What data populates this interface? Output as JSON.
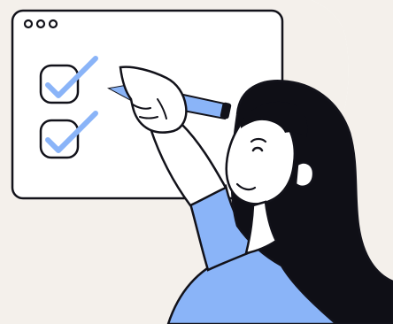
{
  "illustration": {
    "subject": "woman-checking-off-checklist-on-board",
    "icons": [
      "window-dots-icon",
      "checkbox-checked-icon",
      "checkbox-checked-icon",
      "marker-pen-icon"
    ],
    "checklist": {
      "items_checked": 2,
      "items_total": 2
    },
    "colors": {
      "background_blob": "#F4F0EB",
      "board_fill": "#FFFFFF",
      "outline": "#12121A",
      "accent_blue": "#8AB4F8",
      "skin": "#FFFFFF",
      "hair": "#0F0F16"
    }
  }
}
